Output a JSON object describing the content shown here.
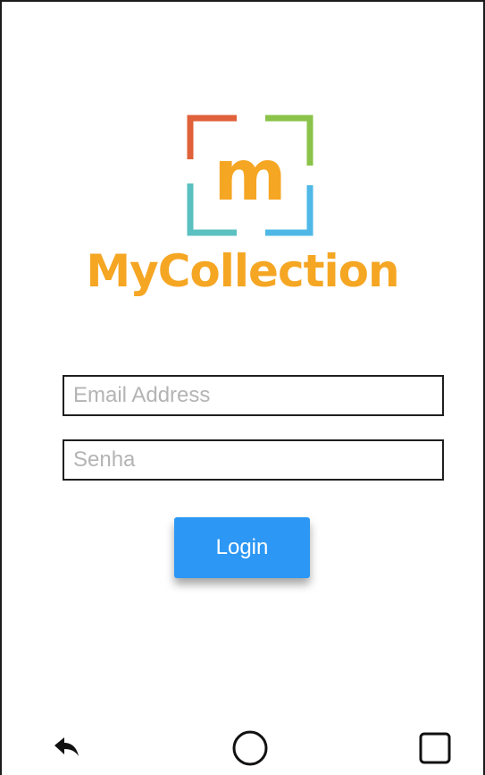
{
  "app": {
    "brand_name": "MyCollection",
    "logo_letter": "m"
  },
  "form": {
    "email_placeholder": "Email Address",
    "password_placeholder": "Senha",
    "login_label": "Login"
  },
  "navbar": {
    "back_icon": "back-arrow-icon",
    "home_icon": "home-circle-icon",
    "recents_icon": "recents-square-icon"
  },
  "colors": {
    "brand": "#f5a623",
    "login_button": "#2c97f4",
    "frame_top_left": "#e0613a",
    "frame_top_right": "#8bc34a",
    "frame_bottom": "#5bc0d8"
  }
}
